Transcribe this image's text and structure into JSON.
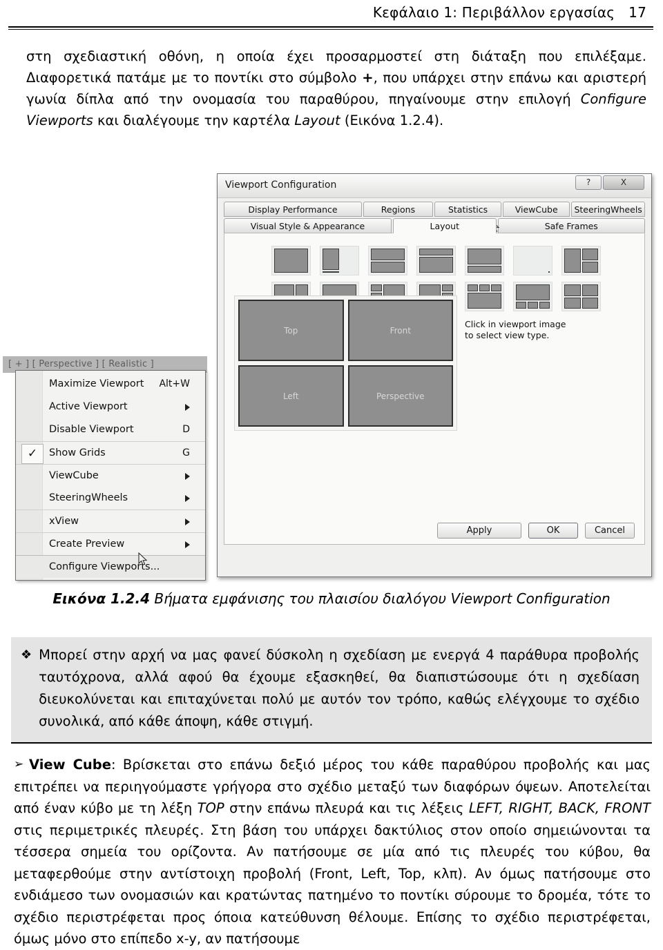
{
  "header": {
    "chapter_title": "Κεφάλαιο 1: Περιβάλλον εργασίας",
    "page_number": "17"
  },
  "intro_paragraph": {
    "part1": "στη σχεδιαστική οθόνη, η οποία έχει προσαρμοστεί στη διάταξη που επιλέξαμε. Διαφορετικά πατάμε με το ποντίκι στο σύμβολο ",
    "plus_symbol": "+",
    "part2": ", που υπάρχει στην επάνω και αριστερή γωνία δίπλα από την ονομασία του παραθύρου, πηγαίνουμε στην επιλογή ",
    "configure_viewports": "Configure Viewports",
    "part3": " και διαλέγουμε την καρτέλα ",
    "layout_word": "Layout",
    "part4": " (Εικόνα 1.2.4)."
  },
  "dialog": {
    "title": "Viewport Configuration",
    "help_button": "?",
    "close_button": "X",
    "tabs_row1": [
      {
        "label": "Display Performance",
        "active": false
      },
      {
        "label": "Regions",
        "active": false
      },
      {
        "label": "Statistics",
        "active": false
      },
      {
        "label": "ViewCube",
        "active": false
      },
      {
        "label": "SteeringWheels",
        "active": false
      }
    ],
    "tabs_row2": [
      {
        "label": "Visual Style & Appearance",
        "active": false
      },
      {
        "label": "Layout",
        "active": true
      },
      {
        "label": "Safe Frames",
        "active": false
      }
    ],
    "viewports": [
      {
        "label": "Top"
      },
      {
        "label": "Front"
      },
      {
        "label": "Left"
      },
      {
        "label": "Perspective"
      }
    ],
    "hint": "Click in viewport image to select view type.",
    "buttons": {
      "apply": "Apply",
      "ok": "OK",
      "cancel": "Cancel"
    },
    "layout_thumbnails": [
      {
        "name": "single",
        "cols": "1fr",
        "rows": "1fr",
        "areas": [
          "a"
        ]
      },
      {
        "name": "two-vertical",
        "cols": "1fr 1fr",
        "rows": "1fr",
        "areas": [
          "a",
          "b"
        ]
      },
      {
        "name": "two-horizontal",
        "cols": "1fr",
        "rows": "1fr 1fr",
        "areas": [
          "a",
          "b"
        ]
      },
      {
        "name": "top-thin-bottom",
        "cols": "1fr",
        "rows": "1fr 2.2fr",
        "areas": [
          "a",
          "b"
        ]
      },
      {
        "name": "top-big-bottom",
        "cols": "1fr",
        "rows": "2.2fr 1fr",
        "areas": [
          "a",
          "b"
        ]
      },
      {
        "name": "left-split-right",
        "cols": "1fr 1fr",
        "rows": "1fr 1fr",
        "areas": [
          "a",
          "b b",
          "c b"
        ]
      },
      {
        "name": "left-right-split",
        "cols": "1fr 1fr",
        "rows": "1fr 1fr",
        "areas": [
          "a b",
          "a c"
        ]
      },
      {
        "name": "top-split-bottom",
        "cols": "1.6fr 1fr",
        "rows": "1fr 1fr",
        "areas": [
          "a b",
          "c c"
        ]
      },
      {
        "name": "top-bottom-split",
        "cols": "1fr 1fr",
        "rows": "1fr 1fr",
        "areas": [
          "a a",
          "b c"
        ]
      },
      {
        "name": "three-left-stack",
        "cols": "1fr 1.9fr",
        "rows": "1fr 1fr 1fr",
        "areas": [
          "a d",
          "b d",
          "c d"
        ]
      },
      {
        "name": "three-right-stack",
        "cols": "1.9fr 1fr",
        "rows": "1fr 1fr 1fr",
        "areas": [
          "a b",
          "a c",
          "a d"
        ]
      },
      {
        "name": "three-top-strip",
        "cols": "1fr 1fr 1fr",
        "rows": "1fr 2.4fr",
        "areas": [
          "a b c",
          "d d d"
        ]
      },
      {
        "name": "three-bottom-strip",
        "cols": "1fr 1fr 1fr",
        "rows": "2.4fr 1fr",
        "areas": [
          "a a a",
          "b c d"
        ]
      },
      {
        "name": "four-quadrant",
        "cols": "1fr 1fr",
        "rows": "1fr 1fr",
        "areas": [
          "a b",
          "c d"
        ]
      }
    ]
  },
  "context_menu": {
    "viewport_label": "[ + ] [ Perspective ] [ Realistic ]",
    "items": [
      {
        "label": "Maximize Viewport",
        "shortcut": "Alt+W",
        "submenu": false,
        "checked": false,
        "separator_above": false,
        "highlight": false
      },
      {
        "label": "Active Viewport",
        "shortcut": "",
        "submenu": true,
        "checked": false,
        "separator_above": false,
        "highlight": false
      },
      {
        "label": "Disable Viewport",
        "shortcut": "D",
        "submenu": false,
        "checked": false,
        "separator_above": false,
        "highlight": false
      },
      {
        "label": "Show Grids",
        "shortcut": "G",
        "submenu": false,
        "checked": true,
        "separator_above": true,
        "highlight": false
      },
      {
        "label": "ViewCube",
        "shortcut": "",
        "submenu": true,
        "checked": false,
        "separator_above": true,
        "highlight": false
      },
      {
        "label": "SteeringWheels",
        "shortcut": "",
        "submenu": true,
        "checked": false,
        "separator_above": false,
        "highlight": false
      },
      {
        "label": "xView",
        "shortcut": "",
        "submenu": true,
        "checked": false,
        "separator_above": true,
        "highlight": false
      },
      {
        "label": "Create Preview",
        "shortcut": "",
        "submenu": true,
        "checked": false,
        "separator_above": true,
        "highlight": false
      },
      {
        "label": "Configure Viewports...",
        "shortcut": "",
        "submenu": false,
        "checked": false,
        "separator_above": true,
        "highlight": true
      }
    ]
  },
  "caption": {
    "label": "Εικόνα 1.2.4",
    "text": " Βήματα εμφάνισης του πλαισίου διαλόγου Viewport Configuration"
  },
  "note_box": {
    "bullet": "❖",
    "text": "Μπορεί στην αρχή να μας φανεί δύσκολη η σχεδίαση με ενεργά 4 παράθυρα προβολής ταυτόχρονα, αλλά αφού θα έχουμε εξασκηθεί, θα διαπιστώσουμε ότι η σχεδίαση διευκολύνεται και επιταχύνεται πολύ με αυτόν τον τρόπο, καθώς ελέγχουμε το σχέδιο συνολικά, από κάθε άποψη, κάθε στιγμή."
  },
  "final_paragraph": {
    "bullet": "➢",
    "term": "View Cube",
    "part1": ": Βρίσκεται στο επάνω δεξιό μέρος του κάθε παραθύρου προβολής και μας επιτρέπει να περιηγούμαστε γρήγορα στο σχέδιο μεταξύ των διαφόρων όψεων. Αποτελείται από έναν κύβο με τη λέξη ",
    "top_word": "TOP",
    "part2": " στην επάνω πλευρά και τις λέξεις ",
    "sides_words": "LEFT, RIGHT, BACK, FRONT",
    "part3": " στις περιμετρικές πλευρές. Στη βάση του υπάρχει δακτύλιος στον οποίο σημειώνονται τα τέσσερα σημεία του ορίζοντα. Αν πατήσουμε σε μία από τις πλευρές του κύβου, θα μεταφερθούμε στην αντίστοιχη προβολή (Front, Left, Top, κλπ). Αν όμως πατήσουμε στο ενδιάμεσο των ονομασιών και κρατώντας πατημένο το ποντίκι σύρουμε το δρομέα, τότε το σχέδιο περιστρέφεται προς όποια κατεύθυνση θέλουμε. Επίσης το σχέδιο περιστρέφεται, όμως μόνο στο επίπεδο x-y, αν πατήσουμε"
  }
}
